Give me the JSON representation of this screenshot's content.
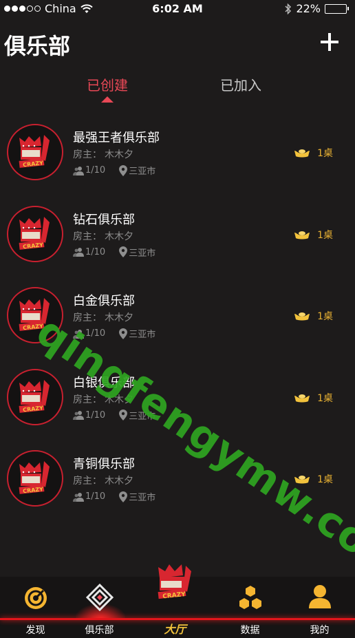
{
  "status_bar": {
    "carrier": "China",
    "time": "6:02 AM",
    "battery": "22%",
    "battery_level": 0.22
  },
  "header": {
    "title": "俱乐部"
  },
  "tabs": [
    {
      "label": "已创建",
      "active": true
    },
    {
      "label": "已加入",
      "active": false
    }
  ],
  "clubs": [
    {
      "name": "最强王者俱乐部",
      "owner_label": "房主：",
      "owner": "木木夕",
      "members": "1/10",
      "city": "三亚市",
      "tables": "1桌"
    },
    {
      "name": "钻石俱乐部",
      "owner_label": "房主：",
      "owner": "木木夕",
      "members": "1/10",
      "city": "三亚市",
      "tables": "1桌"
    },
    {
      "name": "白金俱乐部",
      "owner_label": "房主：",
      "owner": "木木夕",
      "members": "1/10",
      "city": "三亚市",
      "tables": "1桌"
    },
    {
      "name": "白银俱乐部",
      "owner_label": "房主：",
      "owner": "木木夕",
      "members": "1/10",
      "city": "三亚市",
      "tables": "1桌"
    },
    {
      "name": "青铜俱乐部",
      "owner_label": "房主：",
      "owner": "木木夕",
      "members": "1/10",
      "city": "三亚市",
      "tables": "1桌"
    }
  ],
  "avatar_text": "CRAZY",
  "watermark": "qingfengymw.com",
  "bottom_nav": [
    {
      "label": "发现",
      "icon": "target-icon"
    },
    {
      "label": "俱乐部",
      "icon": "club-diamond-icon",
      "active": true
    },
    {
      "label": "大厅",
      "icon": "crazy-logo-icon"
    },
    {
      "label": "数据",
      "icon": "hexagon-cluster-icon"
    },
    {
      "label": "我的",
      "icon": "user-icon"
    }
  ],
  "colors": {
    "accent": "#e84856",
    "gold": "#e9b233",
    "background": "#1d1b1b",
    "nav_line": "#e3151b"
  }
}
